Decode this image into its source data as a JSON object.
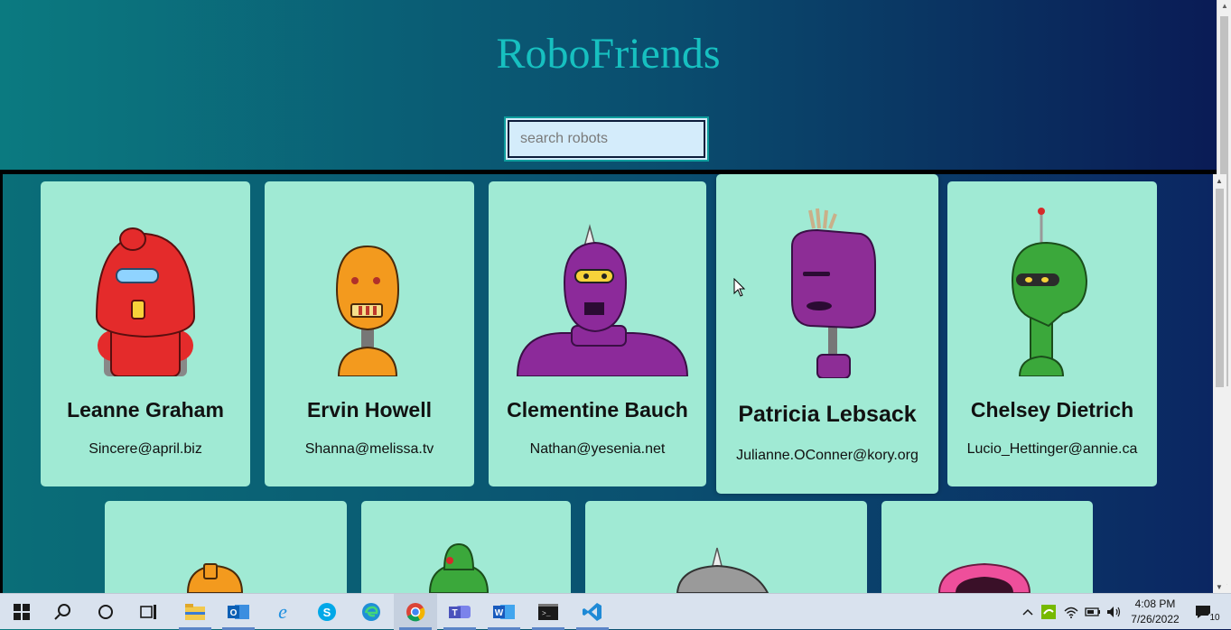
{
  "app": {
    "title": "RoboFriends"
  },
  "search": {
    "placeholder": "search robots"
  },
  "robots": [
    {
      "name": "Leanne Graham",
      "email": "Sincere@april.biz",
      "color": "#e42b2b"
    },
    {
      "name": "Ervin Howell",
      "email": "Shanna@melissa.tv",
      "color": "#f39a1e"
    },
    {
      "name": "Clementine Bauch",
      "email": "Nathan@yesenia.net",
      "color": "#8c2a9a"
    },
    {
      "name": "Patricia Lebsack",
      "email": "Julianne.OConner@kory.org",
      "color": "#8d2d96"
    },
    {
      "name": "Chelsey Dietrich",
      "email": "Lucio_Hettinger@annie.ca",
      "color": "#3ba83b"
    },
    {
      "name": "",
      "email": "",
      "color": "#f39a1e"
    },
    {
      "name": "",
      "email": "",
      "color": "#3ba83b"
    },
    {
      "name": "",
      "email": "",
      "color": "#9a9a9a"
    },
    {
      "name": "",
      "email": "",
      "color": "#ee4f9b"
    }
  ],
  "taskbar": {
    "apps": [
      "start-icon",
      "search-icon",
      "cortana-icon",
      "task-view-icon",
      "file-explorer-icon",
      "outlook-icon",
      "internet-explorer-icon",
      "skype-icon",
      "edge-icon",
      "chrome-icon",
      "teams-icon",
      "word-icon",
      "terminal-icon",
      "vscode-icon"
    ],
    "time": "4:08 PM",
    "date": "7/26/2022",
    "notifications": "10"
  }
}
